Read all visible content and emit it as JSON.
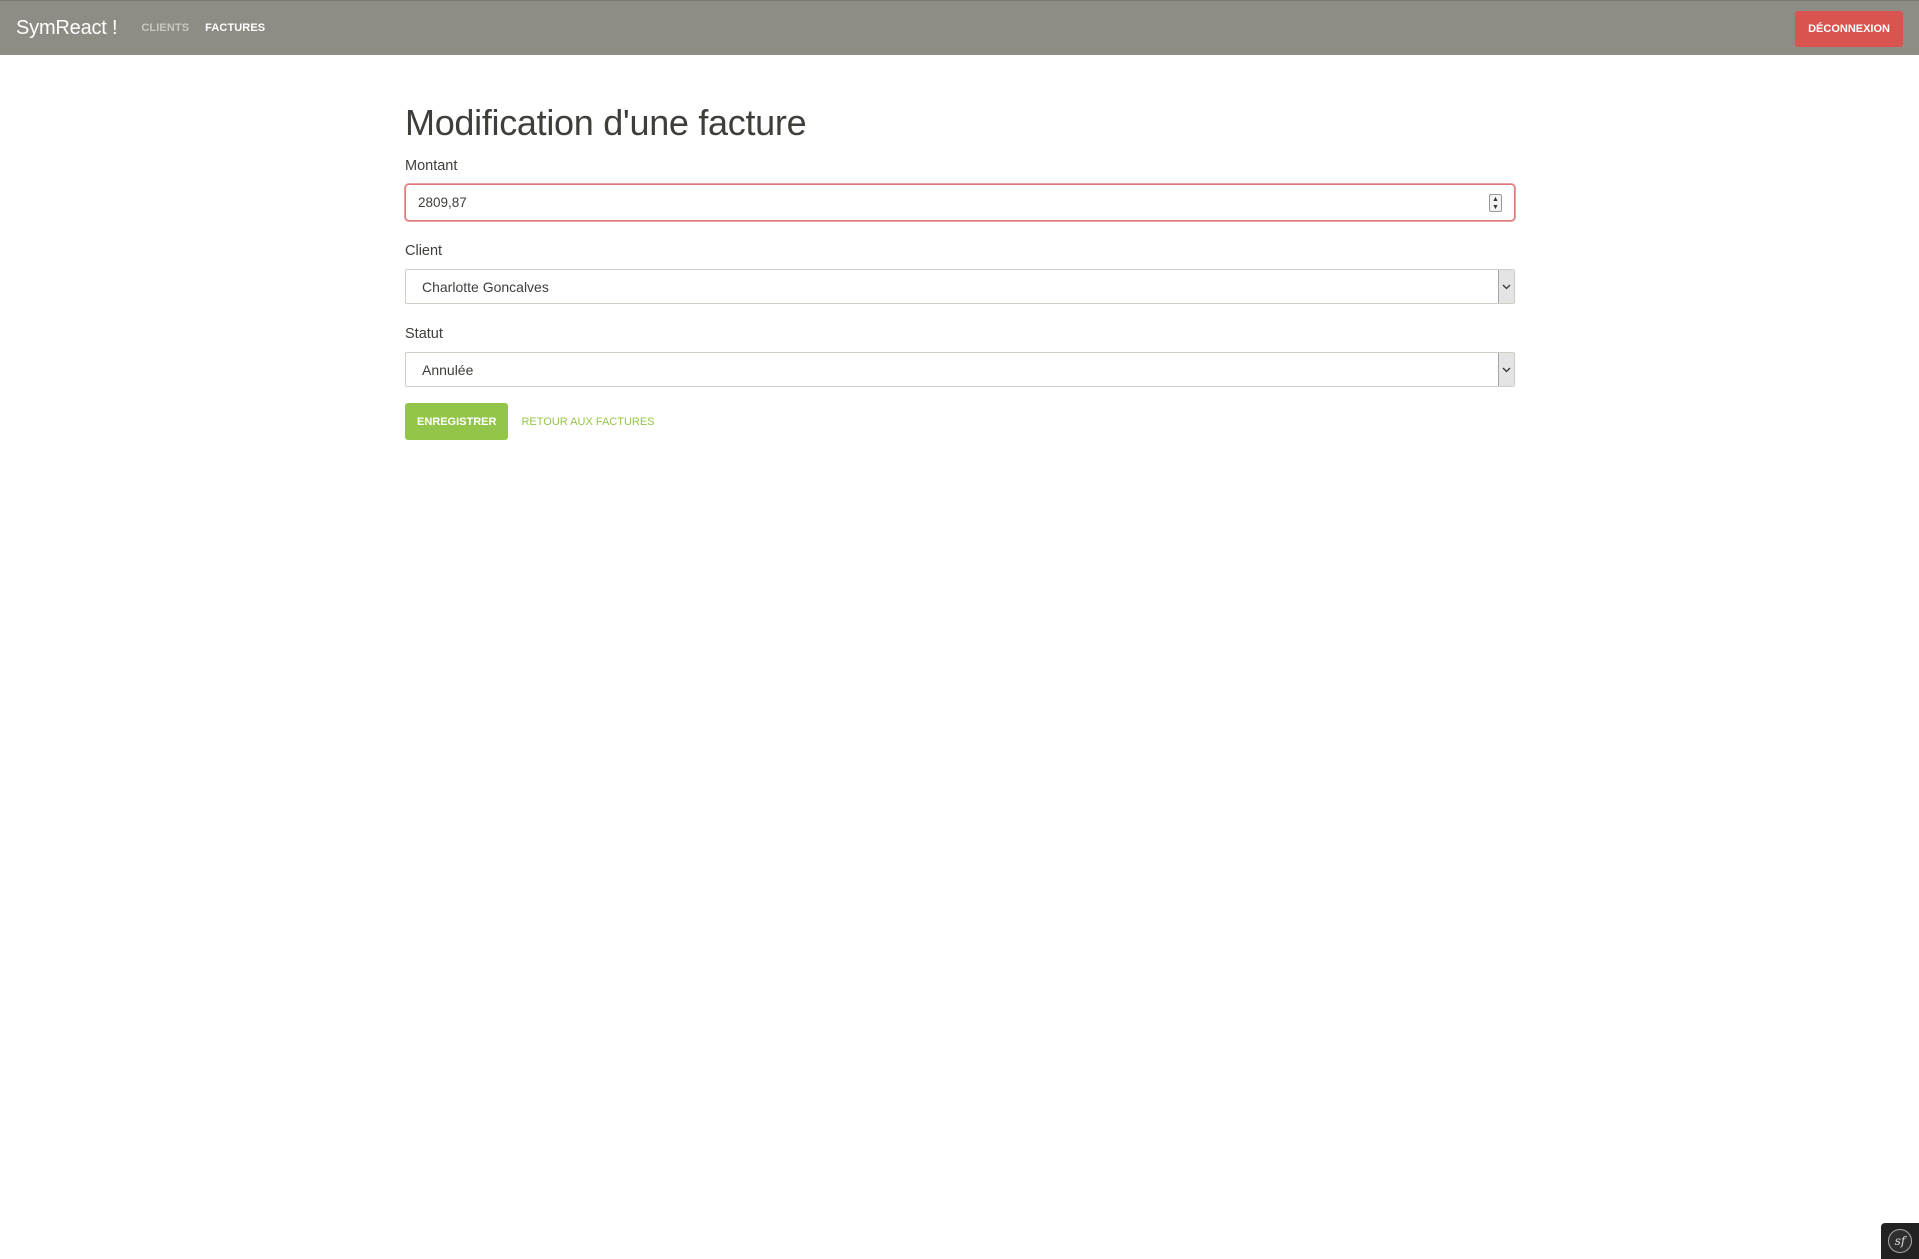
{
  "navbar": {
    "brand": "SymReact !",
    "links": [
      {
        "label": "Clients",
        "active": false
      },
      {
        "label": "Factures",
        "active": true
      }
    ],
    "logout_label": "Déconnexion"
  },
  "page": {
    "title": "Modification d'une facture"
  },
  "form": {
    "amount": {
      "label": "Montant",
      "value": "2809,87"
    },
    "customer": {
      "label": "Client",
      "selected": "Charlotte Goncalves"
    },
    "status": {
      "label": "Statut",
      "selected": "Annulée"
    },
    "save_label": "Enregistrer",
    "back_label": "Retour aux factures"
  },
  "toolbar": {
    "logo_text": "sf"
  },
  "colors": {
    "navbar": "#8e8c84",
    "danger": "#d9534f",
    "success": "#93c54b",
    "invalid_border": "#e0787a"
  },
  "icons": {
    "spinner": "number-spinner-icon",
    "select_arrow": "chevron-down-icon",
    "symfony": "symfony-logo-icon"
  }
}
